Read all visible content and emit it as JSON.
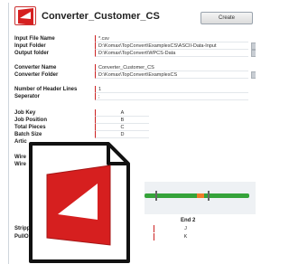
{
  "app": {
    "title": "Converter_Customer_CS",
    "create_button": "Create"
  },
  "fields": {
    "input_file_name": {
      "label": "Input File Name",
      "value": "*.csv"
    },
    "input_folder": {
      "label": "Input Folder",
      "value": "D:\\Komax\\TopConvert\\ExamplesCS\\ASCII-Data-Input"
    },
    "output_folder": {
      "label": "Output folder",
      "value": "D:\\Komax\\TopConvert\\WPCS-Data"
    },
    "converter_name": {
      "label": "Converter Name",
      "value": "Converter_Customer_CS"
    },
    "converter_folder": {
      "label": "Converter Folder",
      "value": "D:\\Komax\\TopConvert\\ExamplesCS"
    },
    "header_lines": {
      "label": "Number of Header Lines",
      "value": "1"
    },
    "separator": {
      "label": "Seperator",
      "value": ";"
    }
  },
  "columns": [
    {
      "label": "Job Key",
      "value": "A"
    },
    {
      "label": "Job Position",
      "value": "B"
    },
    {
      "label": "Total Pieces",
      "value": "C"
    },
    {
      "label": "Batch Size",
      "value": "D"
    },
    {
      "label": "Artic",
      "value": ""
    }
  ],
  "wire_labels": [
    "Wire",
    "Wire"
  ],
  "end2": {
    "title": "End 2",
    "rows": [
      "J",
      "K"
    ]
  },
  "bottom_labels": [
    "Stripp",
    "PullO"
  ],
  "colors": {
    "accent_red": "#cc2222",
    "wire_green": "#35a33a",
    "wire_orange": "#f07b2a"
  },
  "icons": {
    "app_logo": "topconvert-logo-icon"
  }
}
